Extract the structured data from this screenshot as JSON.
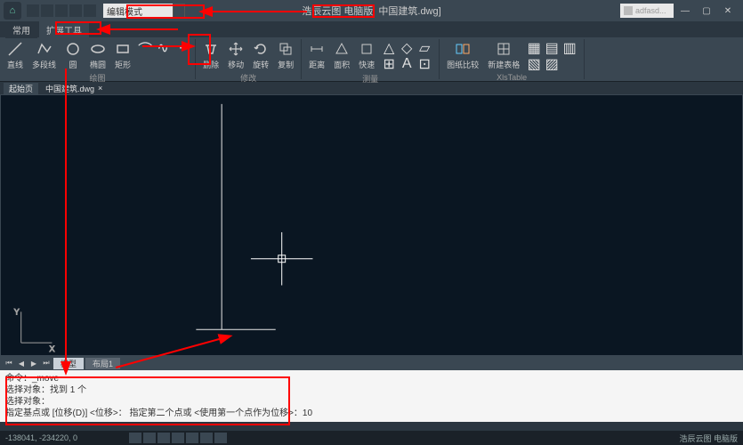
{
  "titlebar": {
    "search_value": "编辑模式",
    "app_name": "浩辰云图 电脑版",
    "filename": "中国建筑.dwg]",
    "user_label": "adfasd..."
  },
  "tabs": {
    "t1": "常用",
    "t2": "扩展工具"
  },
  "ribbon": {
    "draw": {
      "label": "绘图",
      "line": "直线",
      "polyline": "多段线",
      "circle": "圆",
      "ellipse": "椭圆",
      "rect": "矩形"
    },
    "modify": {
      "label": "修改",
      "delete": "删除",
      "move": "移动",
      "rotate": "旋转",
      "copy": "复制"
    },
    "measure": {
      "label": "测量",
      "distance": "距离",
      "area": "面积",
      "quick": "快速"
    },
    "sheet": {
      "label": "图纸比较",
      "compare": "图纸比较",
      "newtable": "新建表格",
      "xlstable": "XlsTable"
    }
  },
  "doc_tabs": {
    "start": "起始页",
    "file": "中国建筑.dwg"
  },
  "sheet_tabs": {
    "model": "模型",
    "layout1": "布局1"
  },
  "command": {
    "l1": "命令：_move",
    "l2": "选择对象：找到 1 个",
    "l3": "选择对象：",
    "l4": "指定基点或 [位移(D)] <位移>：  指定第二个点或 <使用第一个点作为位移>：10"
  },
  "statusbar": {
    "coords": "-138041, -234220, 0",
    "right": "浩辰云图 电脑版"
  }
}
